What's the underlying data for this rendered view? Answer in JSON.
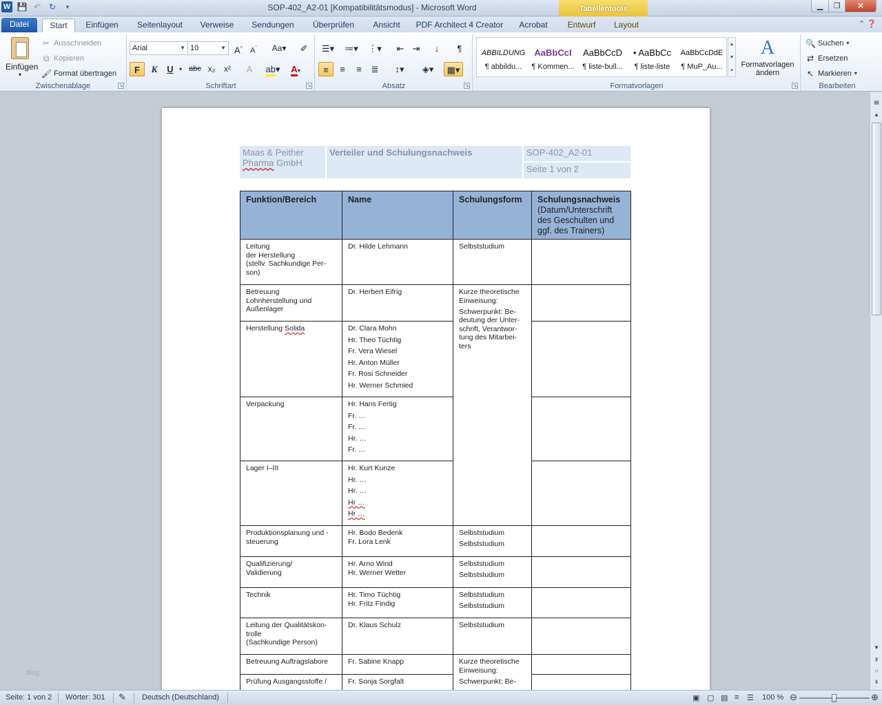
{
  "window": {
    "title": "SOP-402_A2-01 [Kompatibilitätsmodus] - Microsoft Word",
    "context_tab": "Tabellentools",
    "logo": "W"
  },
  "tabs": [
    "Datei",
    "Start",
    "Einfügen",
    "Seitenlayout",
    "Verweise",
    "Sendungen",
    "Überprüfen",
    "Ansicht",
    "PDF Architect 4 Creator",
    "Acrobat",
    "Entwurf",
    "Layout"
  ],
  "ribbon": {
    "clipboard": {
      "paste": "Einfügen",
      "cut": "Ausschneiden",
      "copy": "Kopieren",
      "format_painter": "Format übertragen",
      "label": "Zwischenablage"
    },
    "font": {
      "name": "Arial",
      "size": "10",
      "label": "Schriftart",
      "bold": "F",
      "italic": "K",
      "underline": "U",
      "strike": "abc",
      "sub": "x₂",
      "sup": "x²"
    },
    "paragraph": {
      "label": "Absatz"
    },
    "styles": {
      "label": "Formatvorlagen",
      "items": [
        {
          "sample": "ABBILDUNG",
          "name": "¶ abbildu..."
        },
        {
          "sample": "AaBbCcI",
          "name": "¶ Kommen..."
        },
        {
          "sample": "AaBbCcD",
          "name": "¶ liste-bull..."
        },
        {
          "sample": "• AaBbCc",
          "name": "¶ liste-liste"
        },
        {
          "sample": "AaBbCcDdE",
          "name": "¶ MuP_Au..."
        }
      ],
      "change": "Formatvorlagen ändern"
    },
    "editing": {
      "label": "Bearbeiten",
      "find": "Suchen",
      "replace": "Ersetzen",
      "select": "Markieren"
    }
  },
  "document": {
    "header": {
      "company": "Maas & Peither",
      "company_line2_a": "Pharma",
      "company_line2_b": " GmbH",
      "title": "Verteiler und Schulungsnachweis",
      "doc_id": "SOP-402_A2-01",
      "page": "Seite 1 von 2"
    },
    "table": {
      "headers": {
        "col1": "Funktion/Bereich",
        "col2": "Name",
        "col3": "Schulungsform",
        "col4_bold": "Schulungsnachweis",
        "col4_rest": "(Datum/Unterschrift des Geschulten und ggf. des Trainers)"
      },
      "rows": [
        {
          "func": [
            "Leitung",
            "der Herstellung",
            "(stellv. Sachkundige Per-",
            "son)"
          ],
          "names": [
            "Dr. Hilde Lehmann"
          ],
          "form": [
            "Selbststudium"
          ]
        },
        {
          "func": [
            "Betreuung",
            "Lohnherstellung und",
            "Außenlager"
          ],
          "names": [
            "Dr. Herbert Eifrig"
          ],
          "form": [
            "Kurze theoretische Einweisung:",
            "Schwerpunkt: Be-deutung der Unter-schrift, Verantwor-tung des Mitarbei-ters"
          ]
        },
        {
          "func_a": "Herstellung ",
          "func_b": "Solida",
          "names": [
            "Dr. Clara Mohn",
            "Hr. Theo Tüchtig",
            "Fr. Vera Wiesel",
            "Hr. Anton Müller",
            "Fr. Rosi Schneider",
            "Hr. Werner Schmied"
          ]
        },
        {
          "func": [
            "Verpackung"
          ],
          "names": [
            "Hr. Hans Fertig",
            "Fr. …",
            "Fr. …",
            "Hr. …",
            "Fr. …"
          ]
        },
        {
          "func": [
            "Lager I–III"
          ],
          "names": [
            "Hr. Kurt Kunze",
            "Hr. …",
            "Hr. …",
            "Hr …",
            "Hr …"
          ]
        },
        {
          "func": [
            "Produktionsplanung und -",
            "steuerung"
          ],
          "names": [
            "Hr. Bodo Bedenk",
            "Fr. Lora Lenk"
          ],
          "form": [
            "Selbststudium",
            "Selbststudium"
          ]
        },
        {
          "func": [
            "Qualifizierung/",
            "Validierung"
          ],
          "names": [
            "Hr. Arno Wind",
            "Hr. Werner Wetter"
          ],
          "form": [
            "Selbststudium",
            "Selbststudium"
          ]
        },
        {
          "func": [
            "Technik"
          ],
          "names": [
            "Hr. Timo Tüchtig",
            "Hr. Fritz Findig"
          ],
          "form": [
            "Selbststudium",
            "Selbststudium"
          ]
        },
        {
          "func": [
            "Leitung der Qualitätskon-",
            "trolle",
            "(Sachkundige Person)"
          ],
          "names": [
            "Dr. Klaus Schulz"
          ],
          "form": [
            "Selbststudium"
          ]
        },
        {
          "func": [
            "Betreuung Auftragslabore"
          ],
          "names": [
            "Fr. Sabine Knapp"
          ],
          "form": [
            "Kurze theoretische Einweisung:",
            "Schwerpunkt: Be-"
          ]
        },
        {
          "func": [
            "Prüfung Ausgangsstoffe /"
          ],
          "names": [
            "Fr. Sonja Sorgfalt"
          ]
        }
      ]
    }
  },
  "status": {
    "page": "Seite: 1 von 2",
    "words": "Wörter: 301",
    "language": "Deutsch (Deutschland)",
    "zoom": "100 %",
    "zoom_fraction": 0.5
  },
  "watermark": "blog"
}
